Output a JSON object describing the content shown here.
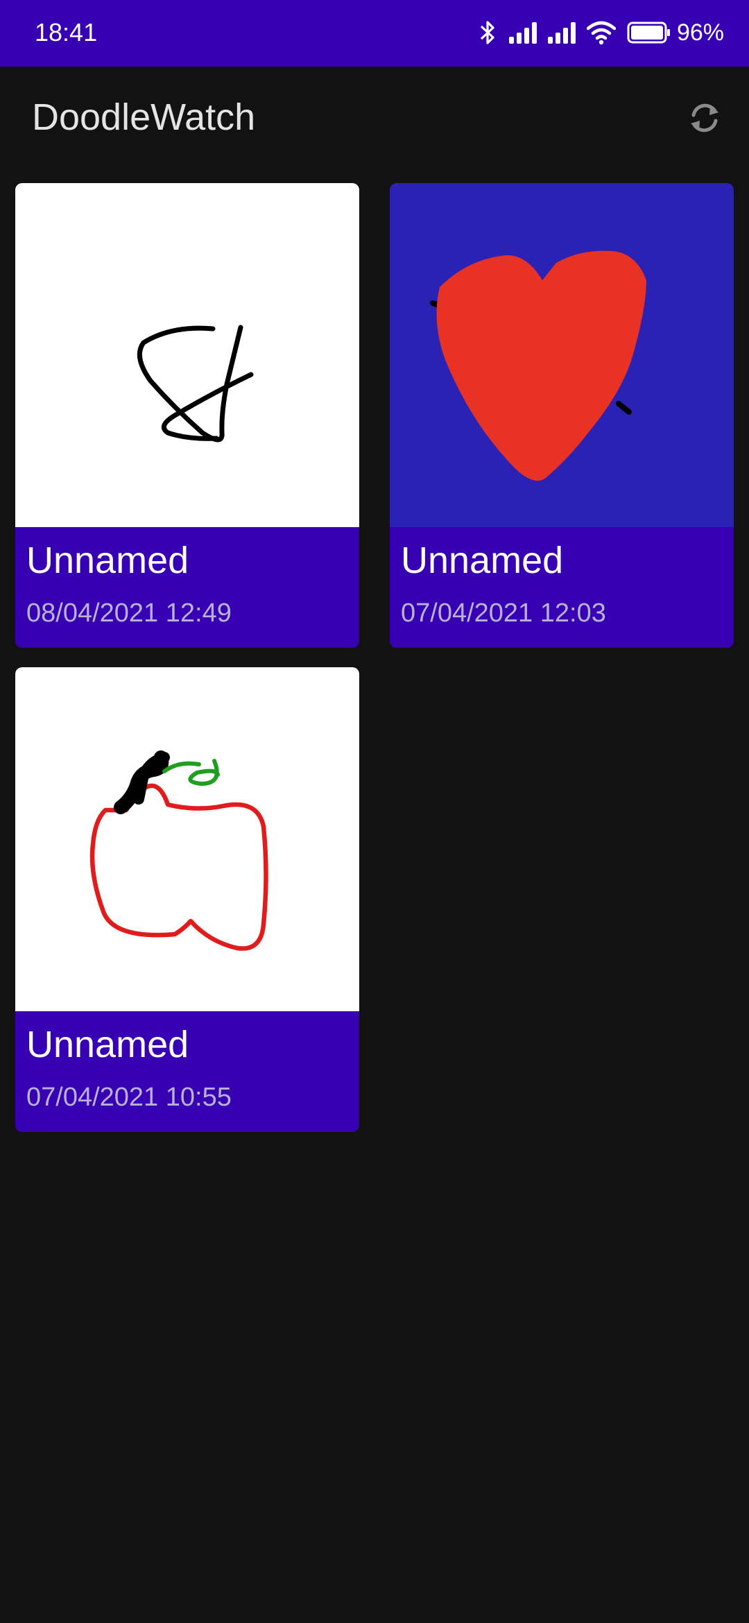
{
  "status_bar": {
    "time": "18:41",
    "battery_percent": "96%",
    "icons": [
      "bluetooth-icon",
      "signal-icon",
      "signal-icon",
      "wifi-icon",
      "battery-icon"
    ]
  },
  "app_bar": {
    "title": "DoodleWatch",
    "sync_icon": "sync-icon"
  },
  "doodles": [
    {
      "title": "Unnamed",
      "date": "08/04/2021 12:49",
      "background": "#ffffff"
    },
    {
      "title": "Unnamed",
      "date": "07/04/2021 12:03",
      "background": "#2a21b5"
    },
    {
      "title": "Unnamed",
      "date": "07/04/2021 10:55",
      "background": "#ffffff"
    }
  ],
  "colors": {
    "primary": "#3700b3",
    "background": "#121212",
    "heart_red": "#e83324",
    "apple_red": "#e01c1c",
    "leaf_green": "#1f9e1f"
  }
}
